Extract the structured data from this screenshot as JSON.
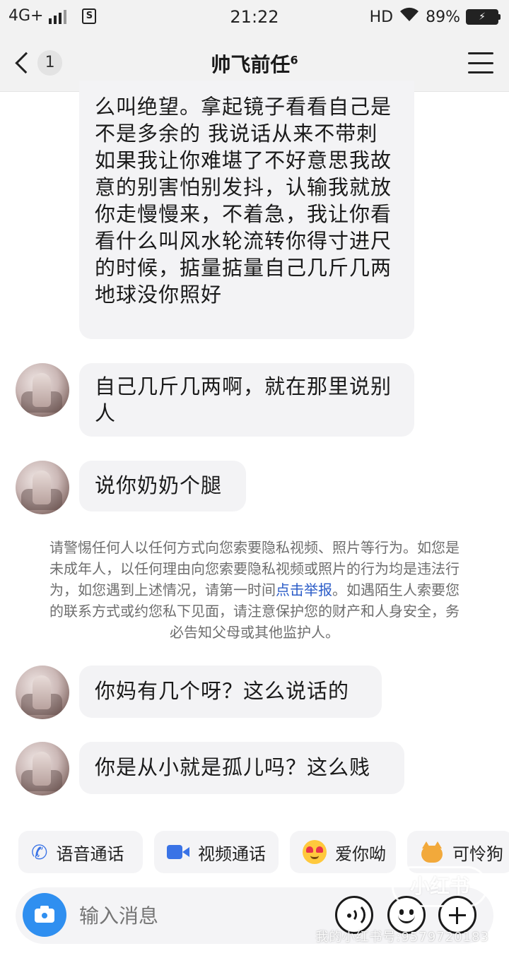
{
  "status_bar": {
    "network": "4G+",
    "time": "21:22",
    "hd": "HD",
    "battery": "89%"
  },
  "header": {
    "back_count": "1",
    "title": "帅飞前任",
    "title_superscript": "6"
  },
  "messages": [
    {
      "text": "么叫绝望。拿起镜子看看自己是不是多余的 我说话从来不带刺 如果我让你难堪了不好意思我故意的别害怕别发抖，认输我就放你走慢慢来，不着急，我让你看看什么叫风水轮流转你得寸进尺的时候，掂量掂量自己几斤几两地球没你照好"
    },
    {
      "text": "自己几斤几两啊，就在那里说别人"
    },
    {
      "text": "说你奶奶个腿"
    },
    {
      "text": "你妈有几个呀？这么说话的"
    },
    {
      "text": "你是从小就是孤儿吗？这么贱"
    }
  ],
  "warning": {
    "before_link": "请警惕任何人以任何方式向您索要隐私视频、照片等行为。如您是未成年人，以任何理由向您索要隐私视频或照片的行为均是违法行为，如您遇到上述情况，请第一时间",
    "link": "点击举报",
    "after_link": "。如遇陌生人索要您的联系方式或约您私下见面，请注意保护您的财产和人身安全，务必告知父母或其他监护人。"
  },
  "quick_replies": [
    {
      "label": "语音通话",
      "icon": "phone-icon"
    },
    {
      "label": "视频通话",
      "icon": "video-icon"
    },
    {
      "label": "爱你呦",
      "icon": "heart-eyes-emoji-icon"
    },
    {
      "label": "可怜狗",
      "icon": "cat-emoji-icon"
    }
  ],
  "input": {
    "placeholder": "输入消息"
  },
  "watermark": {
    "logo": "小红书",
    "text": "我的小红书号:9579720183"
  },
  "colors": {
    "bubble": "#f3f3f5",
    "link": "#2b5cc8",
    "camera": "#2f8ff0",
    "header_bg": "#f2f2f2"
  }
}
